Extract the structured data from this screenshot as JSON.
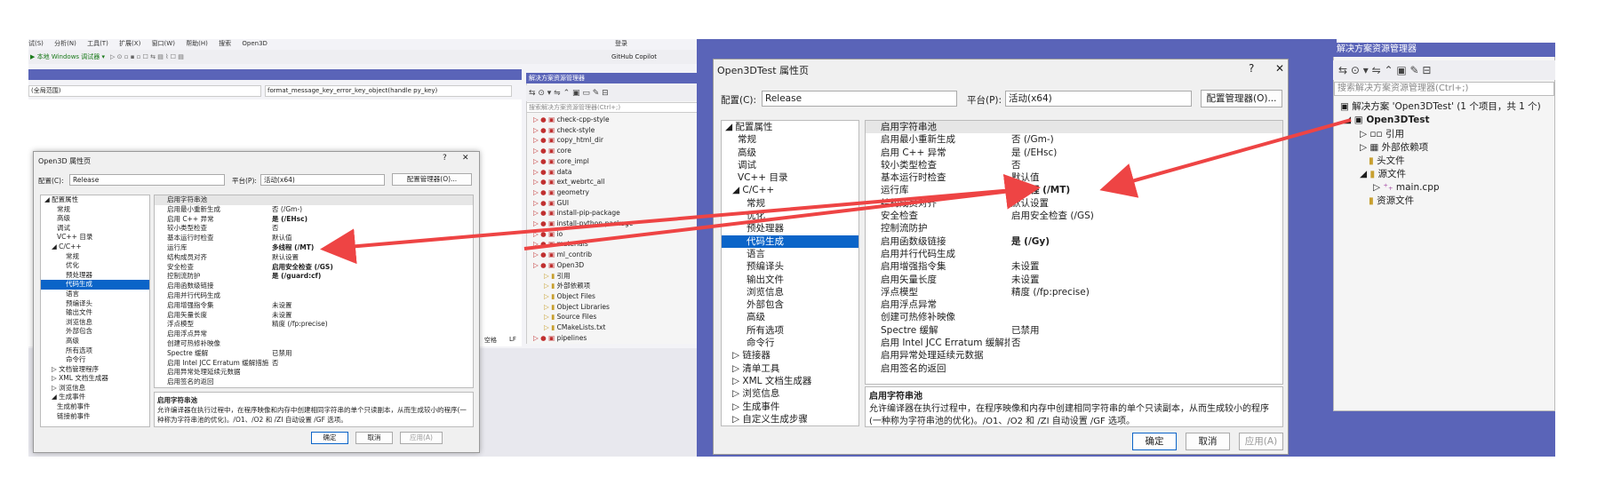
{
  "vs": {
    "menu": [
      "试(S)",
      "分析(N)",
      "工具(T)",
      "扩展(X)",
      "窗口(W)",
      "帮助(H)",
      "搜索",
      "Open3D"
    ],
    "login": "登录",
    "debug_target": "▶ 本地 Windows 调试器 ▾",
    "copilot": "GitHub Copilot",
    "scope_dropdown": "(全局范围)",
    "func_dropdown": "format_message_key_error_key_object(handle py_key)",
    "status_space": "空格",
    "status_lf": "LF"
  },
  "se_small": {
    "title": "解决方案资源管理器",
    "search_placeholder": "搜索解决方案资源管理器(Ctrl+;)",
    "items": [
      "check-cpp-style",
      "check-style",
      "copy_html_dir",
      "core",
      "core_impl",
      "data",
      "ext_webrtc_all",
      "geometry",
      "GUI",
      "install-pip-package",
      "install-python-package",
      "io",
      "materials",
      "ml_contrib",
      "Open3D",
      "引用",
      "外部依赖项",
      "Object Files",
      "Object Libraries",
      "Source Files",
      "CMakeLists.txt",
      "pipelines"
    ]
  },
  "dlg_small": {
    "title": "Open3D 属性页",
    "config_label": "配置(C):",
    "config_value": "Release",
    "platform_label": "平台(P):",
    "platform_value": "活动(x64)",
    "config_mgr": "配置管理器(O)...",
    "tree": [
      "◢ 配置属性",
      "常规",
      "高级",
      "调试",
      "VC++ 目录",
      "◢ C/C++",
      "常规",
      "优化",
      "预处理器",
      "代码生成",
      "语言",
      "预编译头",
      "输出文件",
      "浏览信息",
      "外部包含",
      "高级",
      "所有选项",
      "命令行",
      "▷ 文档管理程序",
      "▷ XML 文档生成器",
      "▷ 浏览信息",
      "◢ 生成事件",
      "生成前事件",
      "链接前事件"
    ],
    "grid": [
      [
        "启用字符串池",
        ""
      ],
      [
        "启用最小重新生成",
        "否 (/Gm-)"
      ],
      [
        "启用 C++ 异常",
        "是 (/EHsc)"
      ],
      [
        "较小类型检查",
        "否"
      ],
      [
        "基本运行时检查",
        "默认值"
      ],
      [
        "运行库",
        "多线程 (/MT)"
      ],
      [
        "结构成员对齐",
        "默认设置"
      ],
      [
        "安全检查",
        "启用安全检查 (/GS)"
      ],
      [
        "控制流防护",
        "是 (/guard:cf)"
      ],
      [
        "启用函数级链接",
        ""
      ],
      [
        "启用并行代码生成",
        ""
      ],
      [
        "启用增强指令集",
        "未设置"
      ],
      [
        "启用矢量长度",
        "未设置"
      ],
      [
        "浮点模型",
        "精度 (/fp:precise)"
      ],
      [
        "启用浮点异常",
        ""
      ],
      [
        "创建可热修补映像",
        ""
      ],
      [
        "Spectre 缓解",
        "已禁用"
      ],
      [
        "启用 Intel JCC Erratum 缓解措施",
        "否"
      ],
      [
        "启用异常处理延续元数据",
        ""
      ],
      [
        "启用签名的返回",
        ""
      ]
    ],
    "desc_title": "启用字符串池",
    "desc_text": "允许编译器在执行过程中，在程序映像和内存中创建相同字符串的单个只读副本，从而生成较小的程序(一种称为字符串池的优化)。/O1、/O2 和 /ZI 自动设置 /GF 选项。",
    "ok": "确定",
    "cancel": "取消",
    "apply": "应用(A)"
  },
  "dlg_large": {
    "title": "Open3DTest 属性页",
    "help": "?",
    "close": "✕",
    "config_label": "配置(C):",
    "config_value": "Release",
    "platform_label": "平台(P):",
    "platform_value": "活动(x64)",
    "config_mgr": "配置管理器(O)...",
    "tree": [
      "◢ 配置属性",
      "常规",
      "高级",
      "调试",
      "VC++ 目录",
      "◢ C/C++",
      "常规",
      "优化",
      "预处理器",
      "代码生成",
      "语言",
      "预编译头",
      "输出文件",
      "浏览信息",
      "外部包含",
      "高级",
      "所有选项",
      "命令行",
      "▷ 链接器",
      "▷ 清单工具",
      "▷ XML 文档生成器",
      "▷ 浏览信息",
      "▷ 生成事件",
      "▷ 自定义生成步骤"
    ],
    "grid": [
      [
        "启用字符串池",
        ""
      ],
      [
        "启用最小重新生成",
        "否 (/Gm-)"
      ],
      [
        "启用 C++ 异常",
        "是 (/EHsc)"
      ],
      [
        "较小类型检查",
        "否"
      ],
      [
        "基本运行时检查",
        "默认值"
      ],
      [
        "运行库",
        "多线程 (/MT)"
      ],
      [
        "结构成员对齐",
        "默认设置"
      ],
      [
        "安全检查",
        "启用安全检查 (/GS)"
      ],
      [
        "控制流防护",
        ""
      ],
      [
        "启用函数级链接",
        "是 (/Gy)"
      ],
      [
        "启用并行代码生成",
        ""
      ],
      [
        "启用增强指令集",
        "未设置"
      ],
      [
        "启用矢量长度",
        "未设置"
      ],
      [
        "浮点模型",
        "精度 (/fp:precise)"
      ],
      [
        "启用浮点异常",
        ""
      ],
      [
        "创建可热修补映像",
        ""
      ],
      [
        "Spectre 缓解",
        "已禁用"
      ],
      [
        "启用 Intel JCC Erratum 缓解措施",
        "否"
      ],
      [
        "启用异常处理延续元数据",
        ""
      ],
      [
        "启用签名的返回",
        ""
      ]
    ],
    "desc_title": "启用字符串池",
    "desc_text": "允许编译器在执行过程中，在程序映像和内存中创建相同字符串的单个只读副本，从而生成较小的程序(一种称为字符串池的优化)。/O1、/O2 和 /ZI 自动设置 /GF 选项。",
    "ok": "确定",
    "cancel": "取消",
    "apply": "应用(A)"
  },
  "se_large": {
    "title": "解决方案资源管理器",
    "search_placeholder": "搜索解决方案资源管理器(Ctrl+;)",
    "solution": "解决方案 'Open3DTest' (1 个项目，共 1 个)",
    "project": "Open3DTest",
    "items": [
      "引用",
      "外部依赖项",
      "头文件",
      "源文件",
      "main.cpp",
      "资源文件"
    ]
  },
  "colors": {
    "accent": "#5a64b8",
    "selection": "#0a64c8",
    "arrow": "#ee4444"
  }
}
